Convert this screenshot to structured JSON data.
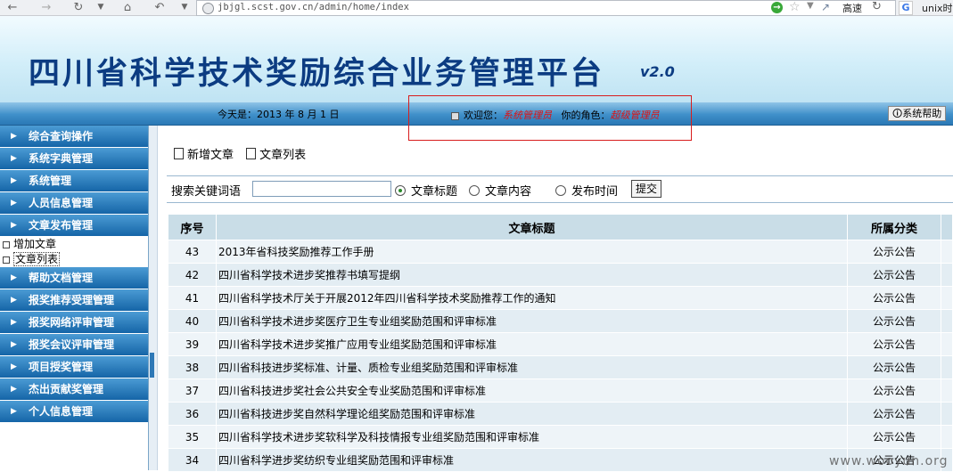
{
  "browser": {
    "url": "jbjgl.scst.gov.cn/admin/home/index",
    "speed_label": "高速",
    "search_text": "unix时"
  },
  "header": {
    "title": "四川省科学技术奖励综合业务管理平台",
    "version": "v2.0"
  },
  "infobar": {
    "date_text": "今天是：2013 年 8 月 1 日",
    "welcome_label": "欢迎您：",
    "user_name": "系统管理员",
    "role_label": "你的角色：",
    "role_name": "超级管理员",
    "help_button": "系统帮助"
  },
  "sidebar": {
    "items": [
      {
        "label": "综合查询操作"
      },
      {
        "label": "系统字典管理"
      },
      {
        "label": "系统管理"
      },
      {
        "label": "人员信息管理"
      },
      {
        "label": "文章发布管理"
      }
    ],
    "subitems": [
      {
        "label": "增加文章"
      },
      {
        "label": "文章列表"
      }
    ],
    "items_after": [
      {
        "label": "帮助文档管理"
      },
      {
        "label": "报奖推荐受理管理"
      },
      {
        "label": "报奖网络评审管理"
      },
      {
        "label": "报奖会议评审管理"
      },
      {
        "label": "项目授奖管理"
      },
      {
        "label": "杰出贡献奖管理"
      },
      {
        "label": "个人信息管理"
      }
    ]
  },
  "actions": {
    "new_article": "新增文章",
    "article_list": "文章列表"
  },
  "search": {
    "label": "搜索关键词语",
    "input_value": "",
    "radio_title": "文章标题",
    "radio_content": "文章内容",
    "radio_date": "发布时间",
    "submit": "提交"
  },
  "table": {
    "headers": [
      "序号",
      "文章标题",
      "所属分类"
    ],
    "rows": [
      {
        "no": "43",
        "title": "2013年省科技奖励推荐工作手册",
        "category": "公示公告"
      },
      {
        "no": "42",
        "title": "四川省科学技术进步奖推荐书填写提纲",
        "category": "公示公告"
      },
      {
        "no": "41",
        "title": "四川省科学技术厅关于开展2012年四川省科学技术奖励推荐工作的通知",
        "category": "公示公告"
      },
      {
        "no": "40",
        "title": "四川省科学技术进步奖医疗卫生专业组奖励范围和评审标准",
        "category": "公示公告"
      },
      {
        "no": "39",
        "title": "四川省科学技术进步奖推广应用专业组奖励范围和评审标准",
        "category": "公示公告"
      },
      {
        "no": "38",
        "title": "四川省科技进步奖标准、计量、质检专业组奖励范围和评审标准",
        "category": "公示公告"
      },
      {
        "no": "37",
        "title": "四川省科技进步奖社会公共安全专业奖励范围和评审标准",
        "category": "公示公告"
      },
      {
        "no": "36",
        "title": "四川省科技进步奖自然科学理论组奖励范围和评审标准",
        "category": "公示公告"
      },
      {
        "no": "35",
        "title": "四川省科学技术进步奖软科学及科技情报专业组奖励范围和评审标准",
        "category": "公示公告"
      },
      {
        "no": "34",
        "title": "四川省科学进步奖纺织专业组奖励范围和评审标准",
        "category": "公示公告"
      }
    ]
  },
  "watermark": "www.wooyun.org"
}
